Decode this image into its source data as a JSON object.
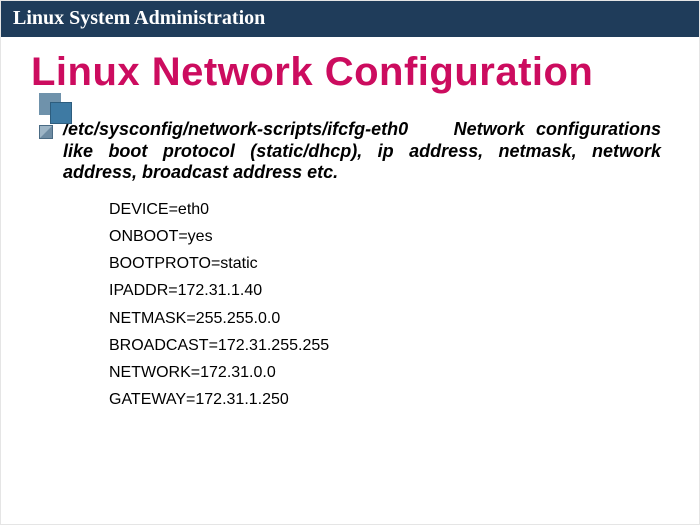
{
  "header": {
    "title": "Linux System Administration"
  },
  "slide": {
    "title": "Linux Network Configuration",
    "bullet": {
      "path": "/etc/sysconfig/network-scripts/ifcfg-eth0",
      "desc": "Network configurations like boot protocol (static/dhcp), ip address, netmask, network address, broadcast address etc."
    },
    "config": [
      "DEVICE=eth0",
      "ONBOOT=yes",
      "BOOTPROTO=static",
      "IPADDR=172.31.1.40",
      "NETMASK=255.255.0.0",
      "BROADCAST=172.31.255.255",
      "NETWORK=172.31.0.0",
      "GATEWAY=172.31.1.250"
    ]
  }
}
